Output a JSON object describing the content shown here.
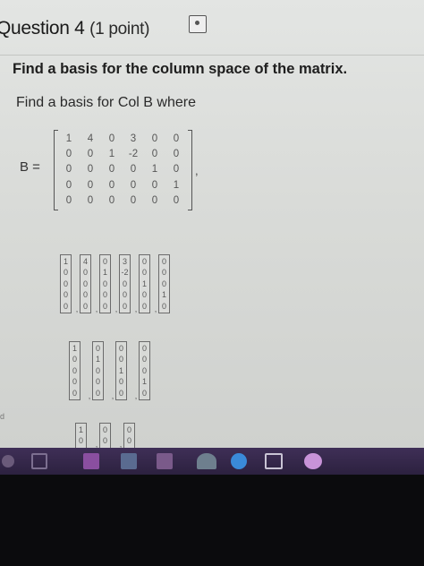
{
  "question": {
    "title": "Question 4",
    "points": "(1 point)",
    "prompt": "Find a basis for the column space of the matrix.",
    "subprompt": "Find a basis for Col B where"
  },
  "matrix": {
    "label": "B =",
    "rows": [
      [
        "1",
        "4",
        "0",
        "3",
        "0",
        "0"
      ],
      [
        "0",
        "0",
        "1",
        "-2",
        "0",
        "0"
      ],
      [
        "0",
        "0",
        "0",
        "0",
        "1",
        "0"
      ],
      [
        "0",
        "0",
        "0",
        "0",
        "0",
        "1"
      ],
      [
        "0",
        "0",
        "0",
        "0",
        "0",
        "0"
      ]
    ],
    "trailing": ","
  },
  "options": [
    {
      "vectors": [
        [
          "1",
          "0",
          "0",
          "0",
          "0"
        ],
        [
          "4",
          "0",
          "0",
          "0",
          "0"
        ],
        [
          "0",
          "1",
          "0",
          "0",
          "0"
        ],
        [
          "3",
          "-2",
          "0",
          "0",
          "0"
        ],
        [
          "0",
          "0",
          "1",
          "0",
          "0"
        ],
        [
          "0",
          "0",
          "0",
          "1",
          "0"
        ]
      ]
    },
    {
      "vectors": [
        [
          "1",
          "0",
          "0",
          "0",
          "0"
        ],
        [
          "0",
          "1",
          "0",
          "0",
          "0"
        ],
        [
          "0",
          "0",
          "1",
          "0",
          "0"
        ],
        [
          "0",
          "0",
          "0",
          "1",
          "0"
        ]
      ]
    },
    {
      "vectors": [
        [
          "1",
          "0"
        ],
        [
          "0",
          "0"
        ],
        [
          "0",
          "0"
        ]
      ]
    }
  ],
  "sidebar_mark": "d",
  "separator": ","
}
